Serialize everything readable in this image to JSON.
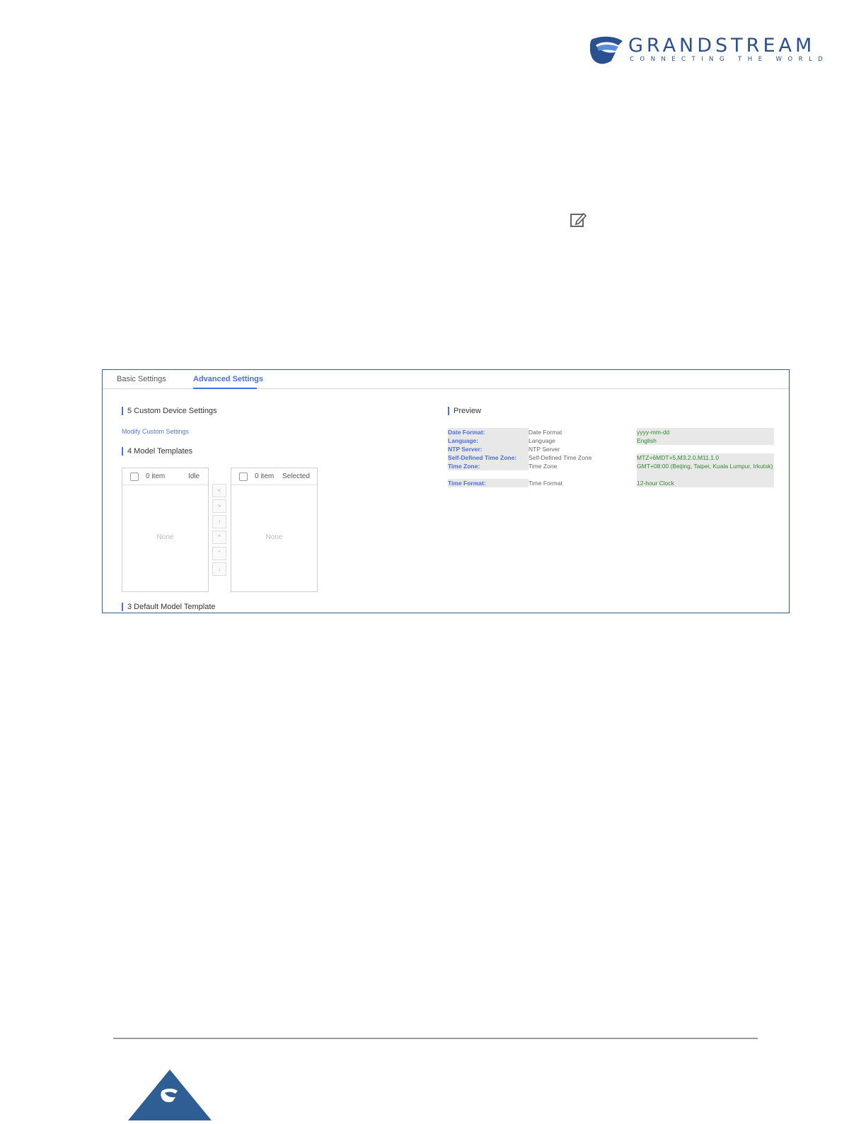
{
  "header": {
    "brand": "GRANDSTREAM",
    "tagline": "CONNECTING THE WORLD"
  },
  "tabs": {
    "basic": "Basic Settings",
    "advanced": "Advanced Settings"
  },
  "custom_device_settings": {
    "title": "5 Custom Device Settings",
    "link": "Modify Custom Settings"
  },
  "model_templates": {
    "title": "4 Model Templates",
    "left": {
      "count": "0 item",
      "label": "Idle",
      "empty": "None"
    },
    "right": {
      "count": "0 item",
      "label": "Selected",
      "empty": "None"
    },
    "buttons": [
      "<",
      ">",
      "↑",
      "^",
      "ˇ",
      "↓"
    ]
  },
  "default_model_template": {
    "title": "3 Default Model Template"
  },
  "preview": {
    "title": "Preview",
    "rows": [
      {
        "label": "Date Format:",
        "name": "Date Format",
        "value": "yyyy-mm-dd"
      },
      {
        "label": "Language:",
        "name": "Language",
        "value": "English"
      },
      {
        "label": "NTP Server:",
        "name": "NTP Server",
        "value": ""
      },
      {
        "label": "Self-Defined Time Zone:",
        "name": "Self-Defined Time Zone",
        "value": "MTZ+6MDT+5,M3.2.0,M11.1.0"
      },
      {
        "label": "Time Zone:",
        "name": "Time Zone",
        "value": "GMT+08:00 (Beijing, Taipei, Kuala Lumpur, Irkutsk)"
      },
      {
        "label": "Time Format:",
        "name": "Time Format",
        "value": "12-hour Clock"
      }
    ]
  },
  "icons": {
    "edit": "edit-icon",
    "logo": "grandstream-logo-icon"
  },
  "colors": {
    "accent": "#4a6ee0",
    "brand": "#2a5090",
    "value_green": "#2d8a2d",
    "panel_border": "#2f5e8e"
  }
}
